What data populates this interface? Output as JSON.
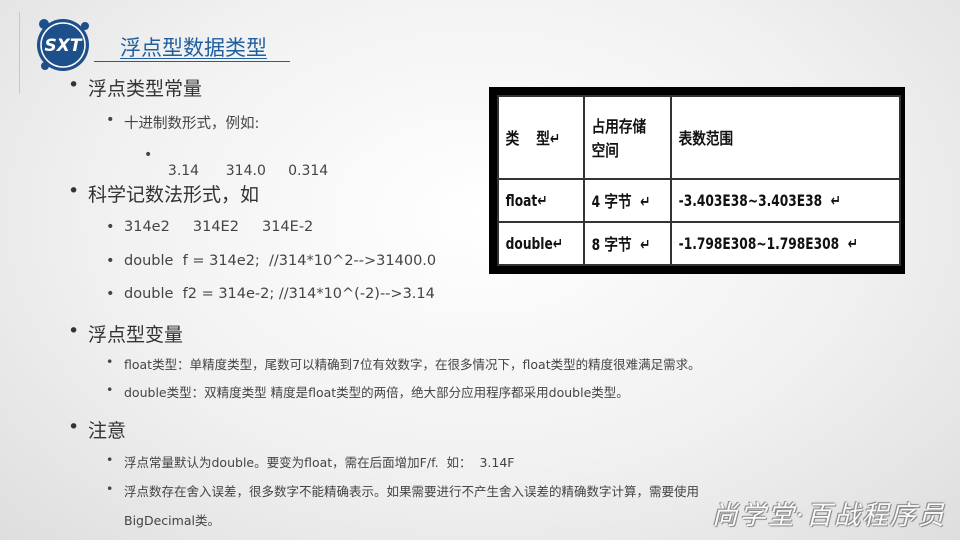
{
  "logo_text": "SXT",
  "title": "浮点型数据类型",
  "sections": [
    {
      "heading": "浮点类型常量"
    },
    {
      "heading": "科学记数法形式，如"
    },
    {
      "heading": "浮点型变量"
    },
    {
      "heading": "注意"
    }
  ],
  "decimal_label": "十进制数形式，例如:",
  "decimal_examples": "3.14      314.0     0.314",
  "sci_examples": [
    "314e2     314E2     314E-2",
    "double  f = 314e2;  //314*10^2-->31400.0",
    "double  f2 = 314e-2; //314*10^(-2)-->3.14"
  ],
  "variable_notes": [
    "float类型：单精度类型，尾数可以精确到7位有效数字，在很多情况下，float类型的精度很难满足需求。",
    "double类型：双精度类型  精度是float类型的两倍，绝大部分应用程序都采用double类型。"
  ],
  "attention_notes": [
    "浮点常量默认为double。要变为float，需在后面增加F/f.  如：  3.14F",
    "浮点数存在舍入误差，很多数字不能精确表示。如果需要进行不产生舍入误差的精确数字计算，需要使用",
    "BigDecimal类。"
  ],
  "table": {
    "header": [
      "类    型↵",
      "占用存储空间",
      "表数范围"
    ],
    "rows": [
      [
        "float↵",
        "4 字节  ↵",
        "-3.403E38~3.403E38  ↵"
      ],
      [
        "double↵",
        "8 字节  ↵",
        "-1.798E308~1.798E308  ↵"
      ]
    ]
  },
  "watermark": "尚学堂·百战程序员",
  "colors": {
    "title": "#1f5f9e",
    "logo": "#1d4f8a"
  }
}
